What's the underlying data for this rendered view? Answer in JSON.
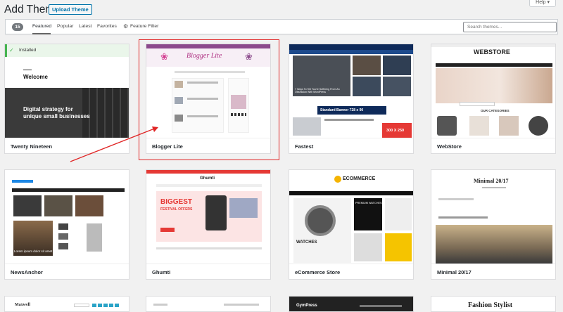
{
  "header": {
    "title": "Add Themes",
    "upload_label": "Upload Theme",
    "help_label": "Help ▾"
  },
  "filters": {
    "count": "15",
    "tabs": [
      {
        "label": "Featured",
        "current": true
      },
      {
        "label": "Popular"
      },
      {
        "label": "Latest"
      },
      {
        "label": "Favorites"
      }
    ],
    "feature_filter": "Feature Filter",
    "search_placeholder": "Search themes..."
  },
  "installed_label": "Installed",
  "themes": [
    {
      "name": "Twenty Nineteen",
      "preview": {
        "heading": "Welcome",
        "tagline_1": "Digital strategy for",
        "tagline_2": "unique small businesses"
      }
    },
    {
      "name": "Blogger Lite",
      "preview": {
        "logo": "Blogger Lite"
      }
    },
    {
      "name": "Fastest",
      "preview": {
        "headline": "7 Ways To Tell You're Suffering From An Obsession With WordPress",
        "banner": "Standard Banner 728 x 90",
        "ad": "300 X 250"
      }
    },
    {
      "name": "WebStore",
      "preview": {
        "logo": "WEBSTORE",
        "section": "OUR CATEGORIES"
      }
    },
    {
      "name": "NewsAnchor",
      "preview": {
        "caption": "Lorem ipsum dolor sit amet"
      }
    },
    {
      "name": "Ghumti",
      "preview": {
        "logo": "Ghumti",
        "promo_1": "BIGGEST",
        "promo_2": "FESTIVAL OFFERS"
      }
    },
    {
      "name": "eCommerce Store",
      "preview": {
        "logo": "ECOMMERCE",
        "label": "WATCHES",
        "promo": "PREMIUM WATCHES"
      }
    },
    {
      "name": "Minimal 20/17",
      "preview": {
        "logo": "Minimal 20/17"
      }
    },
    {
      "name": "",
      "preview": {
        "logo": "Maxwell"
      }
    },
    {
      "name": "",
      "preview": {}
    },
    {
      "name": "",
      "preview": {
        "logo": "GymPress"
      }
    },
    {
      "name": "",
      "preview": {
        "logo": "Fashion Stylist"
      }
    }
  ],
  "colors": {
    "accent": "#0073aa",
    "highlight": "#e02626",
    "installed": "#46b450"
  }
}
